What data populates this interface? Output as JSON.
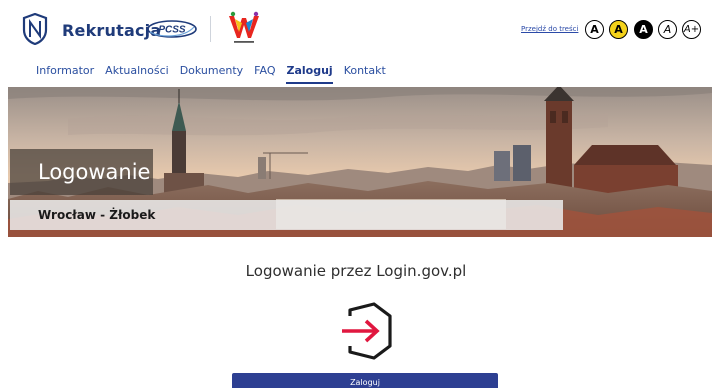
{
  "header": {
    "brand": "Rekrutacja",
    "partner_logo_text": "PCSS",
    "skip_link": "Przejdź do treści",
    "contrast_options": [
      "A",
      "A",
      "A",
      "A",
      "A+"
    ]
  },
  "nav": {
    "items": [
      "Informator",
      "Aktualności",
      "Dokumenty",
      "FAQ",
      "Zaloguj",
      "Kontakt"
    ],
    "active": "Zaloguj"
  },
  "banner": {
    "title": "Logowanie",
    "subtitle": "Wrocław - Żłobek"
  },
  "login": {
    "heading": "Logowanie przez Login.gov.pl",
    "button_label": "Zaloguj",
    "icon": "login-arrow-icon"
  },
  "colors": {
    "brand_navy": "#1f3b7a",
    "nav_link": "#2b4fa0",
    "button_bg": "#2d3f92",
    "login_arrow": "#e0173f",
    "contrast_yellow": "#f4d21b"
  }
}
